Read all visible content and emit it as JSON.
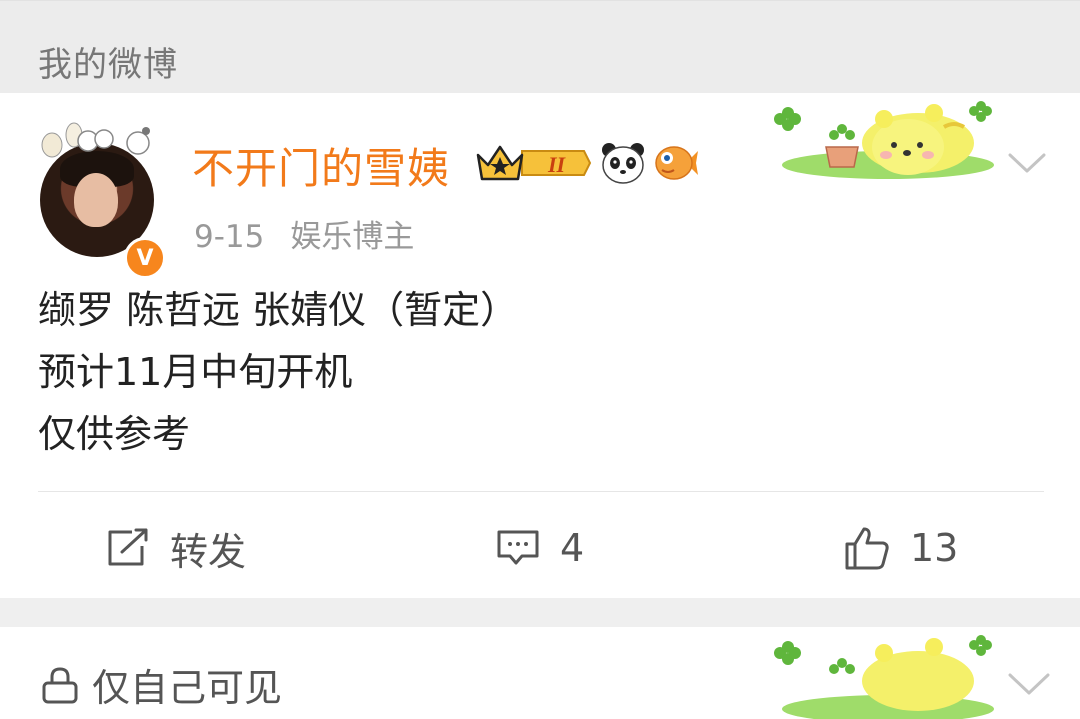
{
  "section": {
    "title": "我的微博"
  },
  "post": {
    "username": "不开门的雪姨",
    "vip_level": "II",
    "date": "9-15",
    "category": "娱乐博主",
    "avatar_badge": "V",
    "text_lines": [
      "缬罗 陈哲远 张婧仪（暂定）",
      "预计11月中旬开机",
      "仅供参考"
    ],
    "actions": {
      "repost_label": "转发",
      "comment_count": "4",
      "like_count": "13"
    }
  },
  "next_post": {
    "privacy_label": "仅自己可见"
  },
  "colors": {
    "username": "#f27a1a",
    "meta": "#999999",
    "text": "#222222",
    "badge": "#f7861d"
  },
  "icons": {
    "crown": "crown-vip-icon",
    "panda": "panda-icon",
    "fish": "fish-icon",
    "repost": "share-icon",
    "comment": "comment-icon",
    "like": "thumbs-up-icon",
    "lock": "lock-icon",
    "more": "chevron-down-icon"
  }
}
